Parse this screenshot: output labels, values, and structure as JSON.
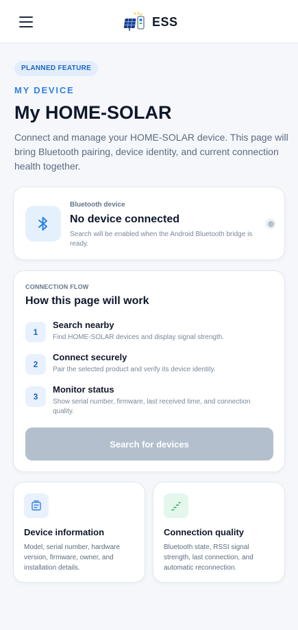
{
  "app": {
    "brand_name": "ESS"
  },
  "header": {
    "menu_icon": "hamburger-menu-icon",
    "logo_icon": "solar-battery-logo-icon"
  },
  "page": {
    "badge": "PLANNED FEATURE",
    "eyebrow": "MY DEVICE",
    "title": "My HOME-SOLAR",
    "lead": "Connect and manage your HOME-SOLAR device. This page will bring Bluetooth pairing, device identity, and current connection health together."
  },
  "device_card": {
    "icon": "bluetooth-icon",
    "label": "Bluetooth device",
    "title": "No device connected",
    "hint": "Search will be enabled when the Android Bluetooth bridge is ready."
  },
  "flow": {
    "eyebrow": "CONNECTION FLOW",
    "title": "How this page will work",
    "steps": [
      {
        "num": "1",
        "title": "Search nearby",
        "desc": "Find HOME-SOLAR devices and display signal strength."
      },
      {
        "num": "2",
        "title": "Connect securely",
        "desc": "Pair the selected product and verify its device identity."
      },
      {
        "num": "3",
        "title": "Monitor status",
        "desc": "Show serial number, firmware, last received time, and connection quality."
      }
    ],
    "button_label": "Search for devices"
  },
  "features": [
    {
      "icon": "device-info-icon",
      "title": "Device information",
      "desc": "Model, serial number, hardware version, firmware, owner, and installation details."
    },
    {
      "icon": "signal-quality-icon",
      "title": "Connection quality",
      "desc": "Bluetooth state, RSSI signal strength, last connection, and automatic reconnection."
    }
  ],
  "colors": {
    "accent": "#2f80e4",
    "badge_bg": "#e3eefc",
    "disabled_button": "#b3bfcd",
    "page_bg": "#f5f7fb",
    "success_tile": "#e3f7ec"
  }
}
